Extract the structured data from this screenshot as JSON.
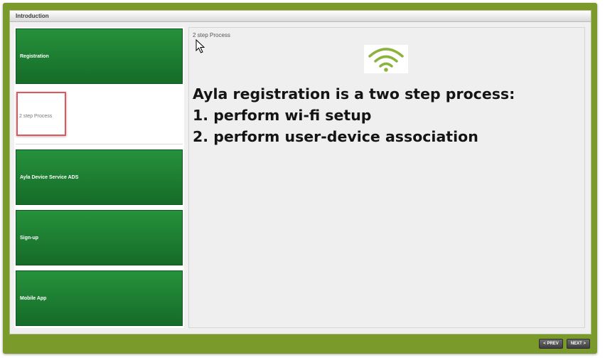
{
  "window": {
    "title": "Introduction"
  },
  "sidebar": {
    "items": [
      {
        "label": "Registration"
      },
      {
        "label": "2 step Process",
        "active": true
      },
      {
        "label": "Ayla Device Service ADS"
      },
      {
        "label": "Sign-up"
      },
      {
        "label": "Mobile App"
      }
    ]
  },
  "content": {
    "slide_label": "2 step Process",
    "icon": "wifi-icon",
    "lines": [
      "Ayla registration is a two step process:",
      "1. perform wi-fi setup",
      "2. perform user-device association"
    ]
  },
  "nav": {
    "prev_label": "< PREV",
    "next_label": "NEXT >"
  },
  "colors": {
    "frame": "#7b9a2c",
    "slide_green": "#1f7f35",
    "wifi": "#8db33f",
    "highlight": "#e0565a"
  }
}
